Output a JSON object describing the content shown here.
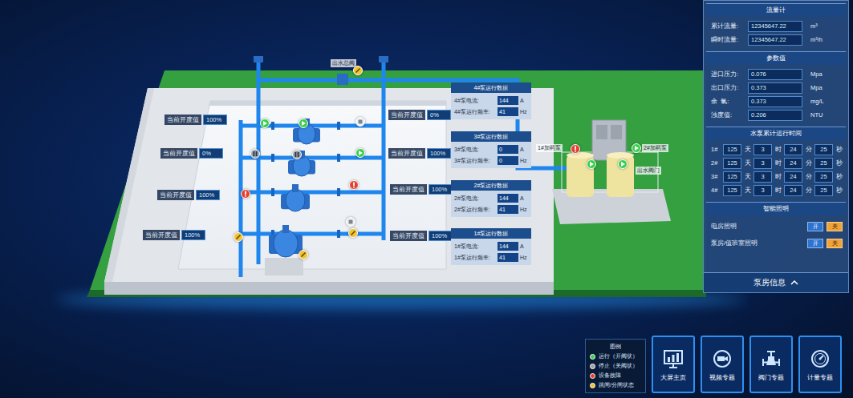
{
  "scene": {
    "device_labels": [
      {
        "text": "出水总阀"
      },
      {
        "text": "1#加药泵"
      },
      {
        "text": "2#加药泵"
      },
      {
        "text": "出水阀门"
      }
    ],
    "left_openings": [
      {
        "label": "当前开度值",
        "value": "100%"
      },
      {
        "label": "当前开度值",
        "value": "0%"
      },
      {
        "label": "当前开度值",
        "value": "100%"
      },
      {
        "label": "当前开度值",
        "value": "100%"
      }
    ],
    "right_openings": [
      {
        "label": "当前开度值",
        "value": "0%"
      },
      {
        "label": "当前开度值",
        "value": "100%"
      },
      {
        "label": "当前开度值",
        "value": "100%"
      },
      {
        "label": "当前开度值",
        "value": "100%"
      }
    ],
    "pump_cards": [
      {
        "title": "4#泵运行数据",
        "rows": [
          {
            "label": "4#泵电流:",
            "value": "144",
            "unit": "A"
          },
          {
            "label": "4#泵运行频率:",
            "value": "41",
            "unit": "Hz"
          }
        ]
      },
      {
        "title": "3#泵运行数据",
        "rows": [
          {
            "label": "3#泵电流:",
            "value": "0",
            "unit": "A"
          },
          {
            "label": "3#泵运行频率:",
            "value": "0",
            "unit": "Hz"
          }
        ]
      },
      {
        "title": "2#泵运行数据",
        "rows": [
          {
            "label": "2#泵电流:",
            "value": "144",
            "unit": "A"
          },
          {
            "label": "2#泵运行频率:",
            "value": "41",
            "unit": "Hz"
          }
        ]
      },
      {
        "title": "1#泵运行数据",
        "rows": [
          {
            "label": "1#泵电流:",
            "value": "144",
            "unit": "A"
          },
          {
            "label": "1#泵运行频率:",
            "value": "41",
            "unit": "Hz"
          }
        ]
      }
    ],
    "markers": [
      {
        "state": "running",
        "color": "#36d14b"
      },
      {
        "state": "running",
        "color": "#36d14b"
      },
      {
        "state": "idle",
        "color": "#f0f3f6"
      },
      {
        "state": "stopped",
        "color": "#9aa3ad"
      },
      {
        "state": "stopped",
        "color": "#9aa3ad"
      },
      {
        "state": "running",
        "color": "#36d14b"
      },
      {
        "state": "fault",
        "color": "#e8402f"
      },
      {
        "state": "fault",
        "color": "#e8402f"
      },
      {
        "state": "trip",
        "color": "#f2c230"
      },
      {
        "state": "trip",
        "color": "#f2c230"
      },
      {
        "state": "trip",
        "color": "#f2c230"
      },
      {
        "state": "trip",
        "color": "#f2c230"
      },
      {
        "state": "running",
        "color": "#36d14b"
      },
      {
        "state": "running",
        "color": "#36d14b"
      },
      {
        "state": "running",
        "color": "#36d14b"
      },
      {
        "state": "fault",
        "color": "#e8402f"
      },
      {
        "state": "idle",
        "color": "#f0f3f6"
      }
    ]
  },
  "panel": {
    "flow": {
      "title": "流量计",
      "rows": [
        {
          "label": "累计流量:",
          "value": "12345647.22",
          "unit": "m³"
        },
        {
          "label": "瞬时流量:",
          "value": "12345647.22",
          "unit": "m³/h"
        }
      ]
    },
    "params": {
      "title": "参数值",
      "rows": [
        {
          "label": "进口压力:",
          "value": "0.076",
          "unit": "Mpa"
        },
        {
          "label": "出口压力:",
          "value": "0.373",
          "unit": "Mpa"
        },
        {
          "label": "余  氯:",
          "value": "0.373",
          "unit": "mg/L"
        },
        {
          "label": "浊度值:",
          "value": "0.206",
          "unit": "NTU"
        }
      ]
    },
    "runtime": {
      "title": "水泵累计运行时间",
      "rows": [
        {
          "pump": "1#",
          "parts": [
            {
              "value": "125",
              "unit": "天"
            },
            {
              "value": "3",
              "unit": "时"
            },
            {
              "value": "24",
              "unit": "分"
            },
            {
              "value": "25",
              "unit": "秒"
            }
          ]
        },
        {
          "pump": "2#",
          "parts": [
            {
              "value": "125",
              "unit": "天"
            },
            {
              "value": "3",
              "unit": "时"
            },
            {
              "value": "24",
              "unit": "分"
            },
            {
              "value": "25",
              "unit": "秒"
            }
          ]
        },
        {
          "pump": "3#",
          "parts": [
            {
              "value": "125",
              "unit": "天"
            },
            {
              "value": "3",
              "unit": "时"
            },
            {
              "value": "24",
              "unit": "分"
            },
            {
              "value": "25",
              "unit": "秒"
            }
          ]
        },
        {
          "pump": "4#",
          "parts": [
            {
              "value": "125",
              "unit": "天"
            },
            {
              "value": "3",
              "unit": "时"
            },
            {
              "value": "24",
              "unit": "分"
            },
            {
              "value": "25",
              "unit": "秒"
            }
          ]
        }
      ]
    },
    "lighting": {
      "title": "智能照明",
      "rows": [
        {
          "label": "电房照明",
          "buttons": [
            {
              "label": "开",
              "selected": false
            },
            {
              "label": "关",
              "selected": true
            }
          ]
        },
        {
          "label": "泵房/值班室照明",
          "buttons": [
            {
              "label": "开",
              "selected": false
            },
            {
              "label": "关",
              "selected": true
            }
          ]
        }
      ]
    },
    "footer": {
      "title": "泵房信息",
      "expanded": true
    }
  },
  "legend": {
    "title": "图例",
    "items": [
      {
        "label": "运行（开阀状）",
        "color": "#36d14b"
      },
      {
        "label": "停止（关阀状）",
        "color": "#9aa3ad"
      },
      {
        "label": "设备故障",
        "color": "#e8402f"
      },
      {
        "label": "跳闸/分闸状态",
        "color": "#f2c230"
      }
    ]
  },
  "nav_buttons": [
    {
      "label": "大屏主页",
      "selected": false
    },
    {
      "label": "视频专题",
      "selected": false
    },
    {
      "label": "阀门专题",
      "selected": false
    },
    {
      "label": "计量专题",
      "selected": false
    }
  ]
}
